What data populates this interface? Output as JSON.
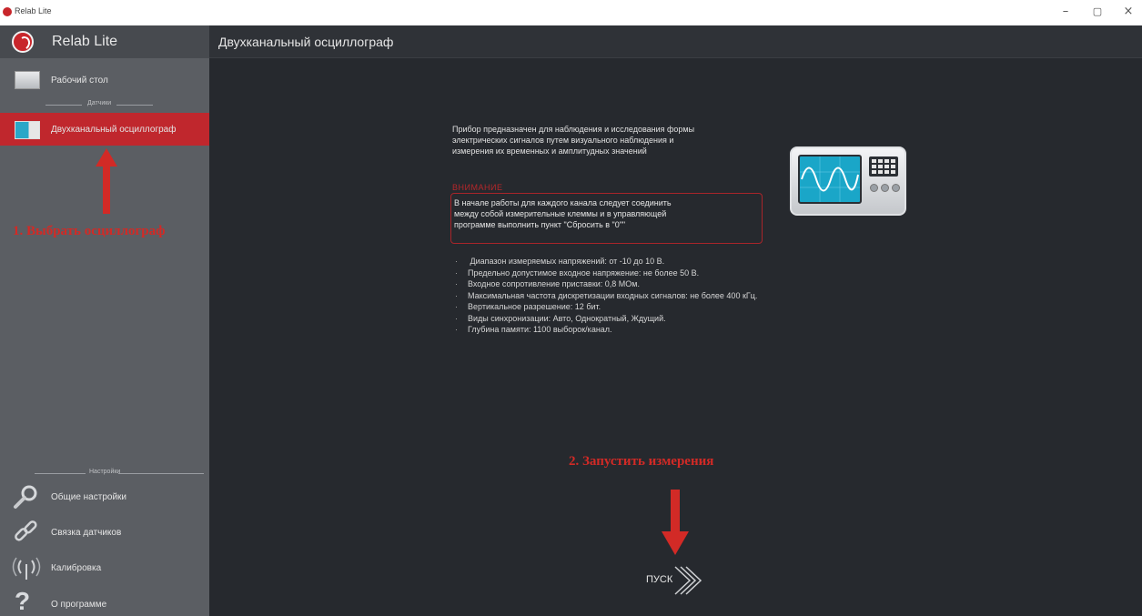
{
  "window": {
    "title": "Relab Lite",
    "minimize": "–",
    "maximize": "▢",
    "close": "×"
  },
  "sidebar": {
    "title": "Relab Lite",
    "items": [
      {
        "label": "Рабочий стол"
      },
      {
        "label": "Двухканальный осциллограф"
      },
      {
        "label": "Общие настройки"
      },
      {
        "label": "Связка датчиков"
      },
      {
        "label": "Калибровка"
      },
      {
        "label": "О программе"
      }
    ],
    "section_sensors": "Датчики",
    "section_settings": "Настройки"
  },
  "annotations": {
    "step1": "1. Выбрать осциллограф",
    "step2": "2. Запустить измерения"
  },
  "main": {
    "title": "Двухканальный осциллограф",
    "description": [
      "Прибор предназначен для наблюдения и исследования формы",
      "электрических сигналов путем визуального наблюдения и",
      "измерения их временных и амплитудных значений"
    ],
    "warning_title": "ВНИМАНИЕ",
    "warning_text": [
      "В начале работы для каждого канала следует соединить",
      "между собой измерительные клеммы и в управляющей",
      "программе выполнить пункт \"Сбросить в \"0\"\""
    ],
    "specs": [
      " Диапазон измеряемых напряжений: от -10 до 10 В.",
      "Предельно допустимое входное напряжение: не более 50 В.",
      "Входное сопротивление приставки: 0,8 МОм.",
      "Максимальная частота дискретизации входных сигналов: не более 400 кГц.",
      "Вертикальное разрешение:   12 бит.",
      "Виды синхронизации: Авто, Однократный, Ждущий.",
      "Глубина памяти: 1100 выборок/канал."
    ],
    "start_label": "ПУСК"
  },
  "colors": {
    "accent": "#c0272d",
    "sidebar": "#5b5e63",
    "main_bg": "#26292e",
    "annotation": "#d22a26"
  }
}
